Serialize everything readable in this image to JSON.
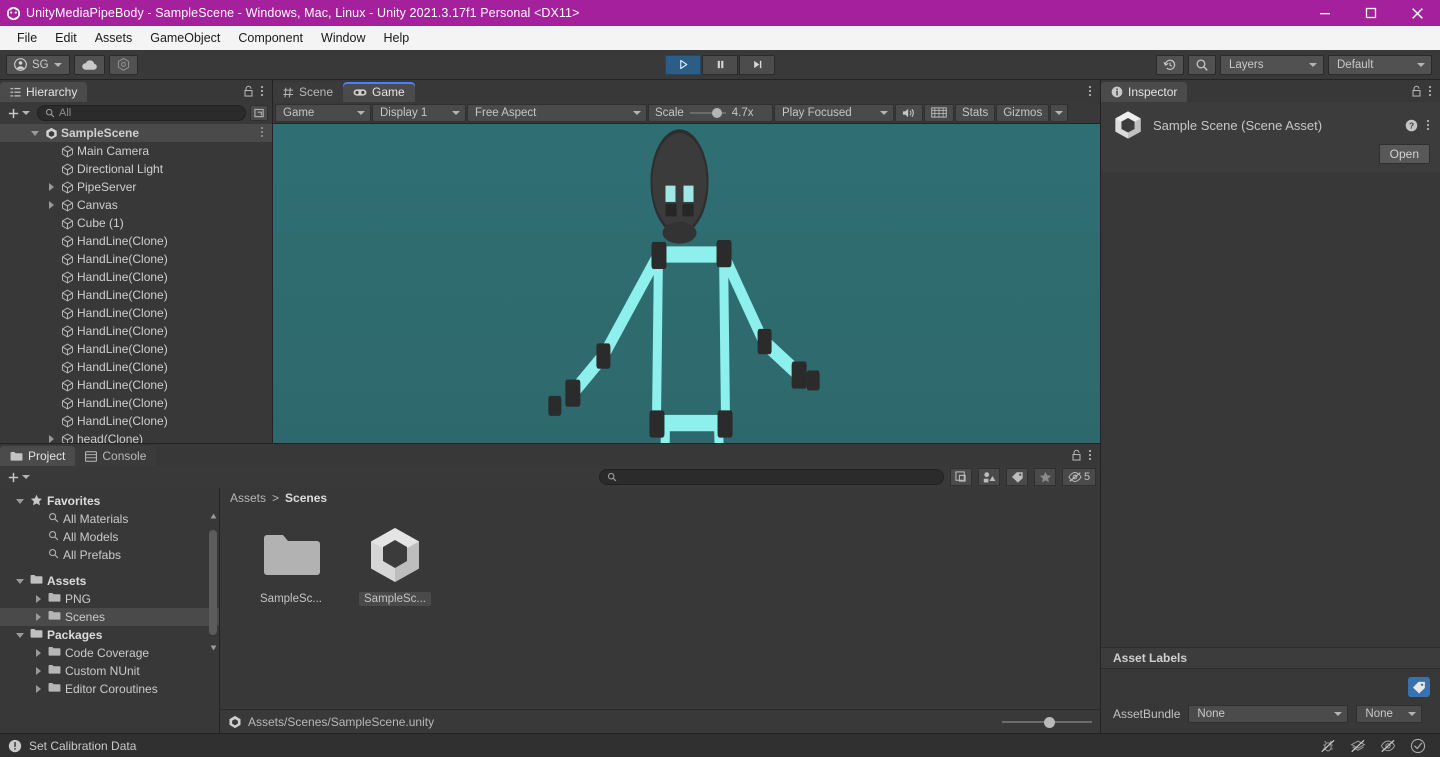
{
  "window": {
    "title": "UnityMediaPipeBody - SampleScene - Windows, Mac, Linux - Unity 2021.3.17f1 Personal <DX11>",
    "app_icon": "unity-icon",
    "minimize_label": "minimize-icon",
    "maximize_label": "maximize-icon",
    "close_label": "close-icon",
    "accent": "#a5209c"
  },
  "menu": {
    "items": [
      "File",
      "Edit",
      "Assets",
      "GameObject",
      "Component",
      "Window",
      "Help"
    ]
  },
  "toolbar": {
    "account_label": "SG",
    "cloud_icon": "cloud-icon",
    "collab_icon": "collab-icon",
    "play_icon": "play-icon",
    "pause_icon": "pause-icon",
    "step_icon": "step-icon",
    "play_active": true,
    "undo_history_icon": "history-icon",
    "search_icon": "search-icon",
    "layers_label": "Layers",
    "layout_label": "Default",
    "accent_active": "#2c5d87"
  },
  "hierarchy": {
    "tab_label": "Hierarchy",
    "tab_icon": "hierarchy-icon",
    "lock_icon": "lock-icon",
    "menu_icon": "kebab-icon",
    "add_label": "+",
    "search_placeholder": "All",
    "search_icon": "search-icon",
    "filter_icon": "filter-icon",
    "items": [
      {
        "label": "SampleScene",
        "depth": 0,
        "arrow": "down",
        "icon": "unity-scene-icon",
        "selected": true,
        "kebab": true
      },
      {
        "label": "Main Camera",
        "depth": 1,
        "arrow": "none",
        "icon": "gameobject-icon"
      },
      {
        "label": "Directional Light",
        "depth": 1,
        "arrow": "none",
        "icon": "gameobject-icon"
      },
      {
        "label": "PipeServer",
        "depth": 1,
        "arrow": "right",
        "icon": "gameobject-icon"
      },
      {
        "label": "Canvas",
        "depth": 1,
        "arrow": "right",
        "icon": "gameobject-icon"
      },
      {
        "label": "Cube (1)",
        "depth": 1,
        "arrow": "none",
        "icon": "gameobject-icon"
      },
      {
        "label": "HandLine(Clone)",
        "depth": 1,
        "arrow": "none",
        "icon": "gameobject-icon"
      },
      {
        "label": "HandLine(Clone)",
        "depth": 1,
        "arrow": "none",
        "icon": "gameobject-icon"
      },
      {
        "label": "HandLine(Clone)",
        "depth": 1,
        "arrow": "none",
        "icon": "gameobject-icon"
      },
      {
        "label": "HandLine(Clone)",
        "depth": 1,
        "arrow": "none",
        "icon": "gameobject-icon"
      },
      {
        "label": "HandLine(Clone)",
        "depth": 1,
        "arrow": "none",
        "icon": "gameobject-icon"
      },
      {
        "label": "HandLine(Clone)",
        "depth": 1,
        "arrow": "none",
        "icon": "gameobject-icon"
      },
      {
        "label": "HandLine(Clone)",
        "depth": 1,
        "arrow": "none",
        "icon": "gameobject-icon"
      },
      {
        "label": "HandLine(Clone)",
        "depth": 1,
        "arrow": "none",
        "icon": "gameobject-icon"
      },
      {
        "label": "HandLine(Clone)",
        "depth": 1,
        "arrow": "none",
        "icon": "gameobject-icon"
      },
      {
        "label": "HandLine(Clone)",
        "depth": 1,
        "arrow": "none",
        "icon": "gameobject-icon"
      },
      {
        "label": "HandLine(Clone)",
        "depth": 1,
        "arrow": "none",
        "icon": "gameobject-icon"
      },
      {
        "label": "head(Clone)",
        "depth": 1,
        "arrow": "right",
        "icon": "gameobject-icon"
      }
    ]
  },
  "center": {
    "tabs": [
      {
        "label": "Scene",
        "icon": "scene-grid-icon",
        "active": false
      },
      {
        "label": "Game",
        "icon": "gamepad-icon",
        "active": true
      }
    ],
    "tab_menu_icon": "kebab-icon",
    "gameview_toolbar": {
      "mode_label": "Game",
      "display_label": "Display 1",
      "aspect_label": "Free Aspect",
      "scale_label": "Scale",
      "scale_value": "4.7x",
      "focus_label": "Play Focused",
      "mute_icon": "speaker-icon",
      "stats_toggle_icon": "grid-icon",
      "stats_label": "Stats",
      "gizmos_label": "Gizmos"
    },
    "render": {
      "sky_color": "#2f6a6e",
      "ground_color": "#8aab3c",
      "skeleton_color": "#8ef0ec",
      "joint_color": "#2e2e2e",
      "head_color": "#3a3a3a",
      "description": "Cyan stick-figure body tracking skeleton standing on green ground"
    }
  },
  "project": {
    "tabs": [
      {
        "label": "Project",
        "icon": "folder-icon",
        "active": true
      },
      {
        "label": "Console",
        "icon": "console-icon",
        "active": false
      }
    ],
    "lock_icon": "lock-icon",
    "menu_icon": "kebab-icon",
    "add_label": "+",
    "search_placeholder": "",
    "search_icon": "search-icon",
    "toolbar_icons": [
      "save-search-icon",
      "filter-type-icon",
      "filter-label-icon",
      "favorite-star-icon",
      "hidden-packages-icon"
    ],
    "hidden_packages_count": "5",
    "tree": [
      {
        "label": "Favorites",
        "depth": 0,
        "arrow": "down",
        "icon": "star-icon",
        "bold": true
      },
      {
        "label": "All Materials",
        "depth": 1,
        "arrow": "none",
        "icon": "search-icon"
      },
      {
        "label": "All Models",
        "depth": 1,
        "arrow": "none",
        "icon": "search-icon"
      },
      {
        "label": "All Prefabs",
        "depth": 1,
        "arrow": "none",
        "icon": "search-icon"
      },
      {
        "label": "",
        "depth": 0,
        "arrow": "none",
        "icon": "none",
        "spacer": true
      },
      {
        "label": "Assets",
        "depth": 0,
        "arrow": "down",
        "icon": "folder-open-icon",
        "bold": true
      },
      {
        "label": "PNG",
        "depth": 1,
        "arrow": "right",
        "icon": "folder-icon"
      },
      {
        "label": "Scenes",
        "depth": 1,
        "arrow": "right",
        "icon": "folder-icon",
        "selected": true
      },
      {
        "label": "Packages",
        "depth": 0,
        "arrow": "down",
        "icon": "folder-open-icon",
        "bold": true
      },
      {
        "label": "Code Coverage",
        "depth": 1,
        "arrow": "right",
        "icon": "folder-icon"
      },
      {
        "label": "Custom NUnit",
        "depth": 1,
        "arrow": "right",
        "icon": "folder-icon"
      },
      {
        "label": "Editor Coroutines",
        "depth": 1,
        "arrow": "right",
        "icon": "folder-icon"
      }
    ],
    "breadcrumb": [
      "Assets",
      "Scenes"
    ],
    "breadcrumb_separator": ">",
    "assets": [
      {
        "label": "SampleSc...",
        "type": "folder",
        "selected": false
      },
      {
        "label": "SampleSc...",
        "type": "unity-scene",
        "selected": true
      }
    ],
    "footer_path": "Assets/Scenes/SampleScene.unity",
    "footer_icon": "unity-scene-icon"
  },
  "inspector": {
    "tab_label": "Inspector",
    "tab_icon": "info-icon",
    "lock_icon": "lock-icon",
    "menu_icon": "kebab-icon",
    "object_name": "Sample Scene (Scene Asset)",
    "object_icon": "unity-scene-icon",
    "help_icon": "help-icon",
    "preset_icon": "kebab-icon",
    "open_button": "Open",
    "asset_labels_header": "Asset Labels",
    "tag_icon": "tag-icon",
    "assetbundle_label": "AssetBundle",
    "assetbundle_value": "None",
    "assetbundle_variant": "None"
  },
  "statusbar": {
    "icon": "warning-icon",
    "message": "Set Calibration Data",
    "right_icons": [
      "mute-bug-icon",
      "layers-off-icon",
      "preview-off-icon",
      "check-circle-icon"
    ]
  }
}
